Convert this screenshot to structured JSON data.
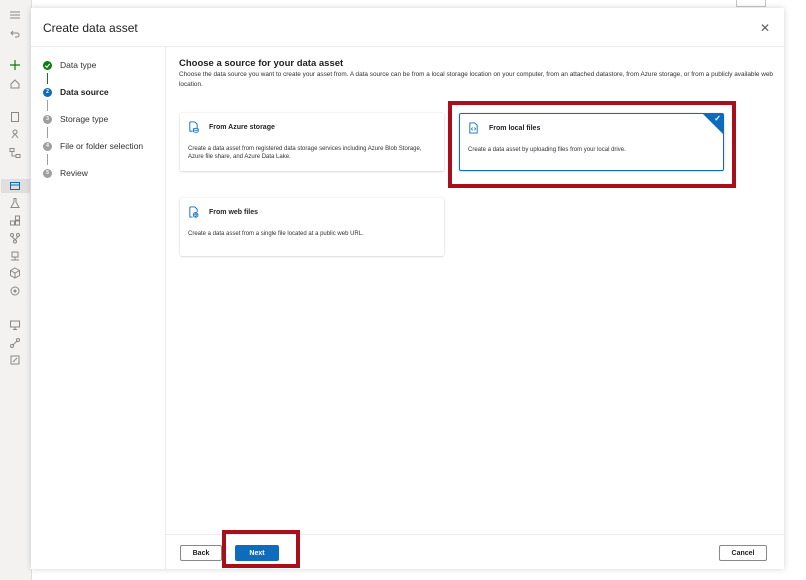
{
  "dialog": {
    "title": "Create data asset",
    "close_glyph": "✕"
  },
  "steps": [
    {
      "label": "Data type",
      "status": "done"
    },
    {
      "label": "Data source",
      "status": "current",
      "number": "2"
    },
    {
      "label": "Storage type",
      "status": "todo",
      "number": "3"
    },
    {
      "label": "File or folder selection",
      "status": "todo",
      "number": "4"
    },
    {
      "label": "Review",
      "status": "todo",
      "number": "5"
    }
  ],
  "main": {
    "title": "Choose a source for your data asset",
    "description": "Choose the data source you want to create your asset from. A data source can be from a local storage location on your computer, from an attached datastore, from Azure storage, or from a publicly available web location."
  },
  "cards": [
    {
      "title": "From Azure storage",
      "description": "Create a data asset from registered data storage services including Azure Blob Storage, Azure file share, and Azure Data Lake.",
      "icon": "azure-storage-icon",
      "selected": false
    },
    {
      "title": "From local files",
      "description": "Create a data asset by uploading files from your local drive.",
      "icon": "local-file-icon",
      "selected": true
    },
    {
      "title": "From web files",
      "description": "Create a data asset from a single file located at a public web URL.",
      "icon": "web-file-icon",
      "selected": false
    }
  ],
  "footer": {
    "back_label": "Back",
    "next_label": "Next",
    "cancel_label": "Cancel"
  },
  "colors": {
    "accent": "#0f6cbd",
    "success": "#107c10",
    "highlight": "#a80f1a"
  }
}
